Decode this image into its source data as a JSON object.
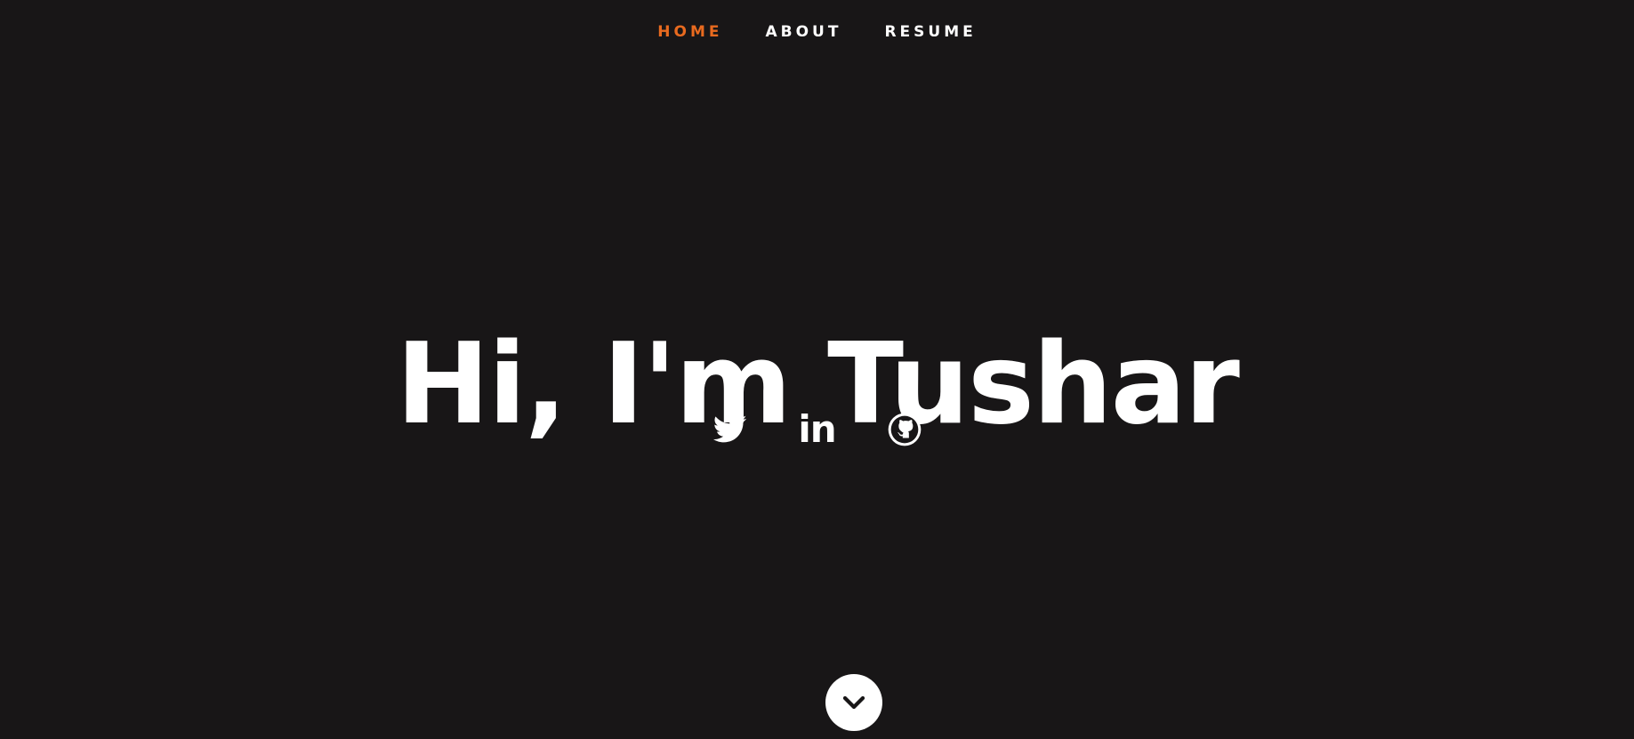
{
  "nav": {
    "items": [
      {
        "label": "HOME",
        "active": true
      },
      {
        "label": "ABOUT",
        "active": false
      },
      {
        "label": "RESUME",
        "active": false
      }
    ]
  },
  "hero": {
    "title": "Hi, I'm Tushar"
  },
  "social": {
    "icons": [
      "twitter-icon",
      "linkedin-icon",
      "github-icon"
    ],
    "linkedin_glyph": "in"
  },
  "scroll": {
    "icon": "chevron-down-icon"
  },
  "colors": {
    "background": "#181617",
    "accent": "#e86a1f",
    "text": "#ffffff"
  }
}
